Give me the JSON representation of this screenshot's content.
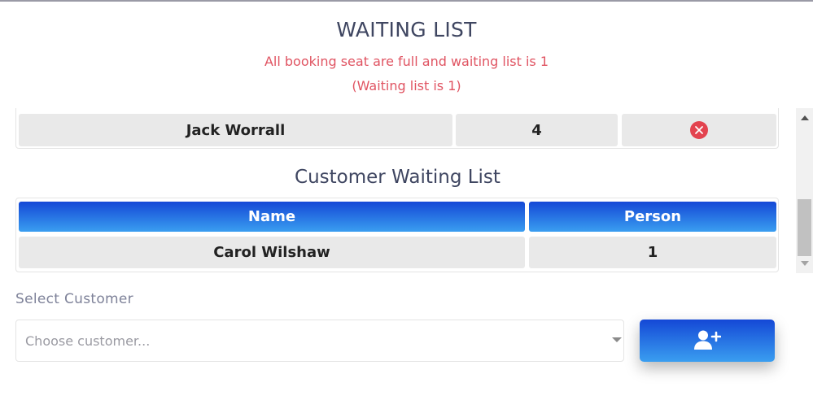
{
  "modal": {
    "title": "WAITING LIST",
    "message_full": "All booking seat are full and waiting list is 1",
    "message_count": "(Waiting list is 1)"
  },
  "booked_table": {
    "rows": [
      {
        "name": "Jack Worrall",
        "persons": "4",
        "action_icon": "remove-circle-icon"
      }
    ]
  },
  "waiting_section": {
    "title": "Customer Waiting List",
    "headers": {
      "name": "Name",
      "person": "Person"
    },
    "rows": [
      {
        "name": "Carol Wilshaw",
        "person": "1"
      }
    ]
  },
  "select_customer": {
    "label": "Select Customer",
    "placeholder": "Choose customer..."
  },
  "add_button": {
    "icon": "add-user-icon"
  },
  "colors": {
    "accent_gradient_top": "#1448d6",
    "accent_gradient_bottom": "#3a9ef0",
    "alert_text": "#e05462",
    "danger": "#e3434f"
  }
}
